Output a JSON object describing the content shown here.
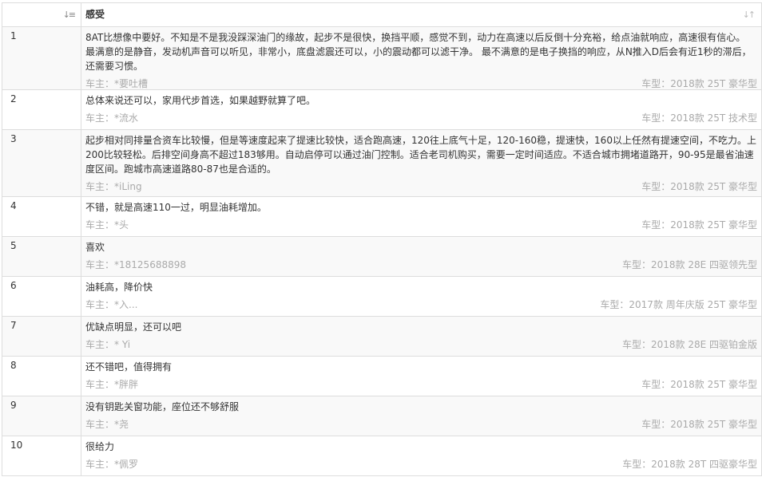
{
  "table": {
    "header": {
      "col_feeling": "感受"
    },
    "user_prefix": "车主：",
    "model_prefix": "车型：",
    "rows": [
      {
        "index": "1",
        "feeling": "8AT比想像中要好。不知是不是我没踩深油门的缘故，起步不是很快，换挡平顺，感觉不到，动力在高速以后反倒十分充裕，给点油就响应，高速很有信心。 最满意的是静音，发动机声音可以听见，非常小，底盘滤震还可以，小的震动都可以滤干净。 最不满意的是电子换挡的响应，从N推入D后会有近1秒的滞后，还需要习惯。",
        "user": "*要吐槽",
        "model": "2018款 25T 豪华型"
      },
      {
        "index": "2",
        "feeling": "总体来说还可以，家用代步首选，如果越野就算了吧。",
        "user": "*流水",
        "model": "2018款 25T 技术型"
      },
      {
        "index": "3",
        "feeling": "起步相对同排量合资车比较慢，但是等速度起来了提速比较快，适合跑高速，120往上底气十足，120-160稳，提速快，160以上任然有提速空间，不吃力。上200比较轻松。后排空间身高不超过183够用。自动启停可以通过油门控制。适合老司机购买，需要一定时间适应。不适合城市拥堵道路开，90-95是最省油速度区间。跑城市高速道路80-87也是合适的。",
        "user": "*iLing",
        "model": "2018款 25T 豪华型"
      },
      {
        "index": "4",
        "feeling": "不错，就是高速110一过，明显油耗增加。",
        "user": "*头",
        "model": "2018款 25T 豪华型"
      },
      {
        "index": "5",
        "feeling": "喜欢",
        "user": "*18125688898",
        "model": "2018款 28E 四驱领先型"
      },
      {
        "index": "6",
        "feeling": "油耗高，降价快",
        "user": "*入...",
        "model": "2017款 周年庆版 25T 豪华型"
      },
      {
        "index": "7",
        "feeling": "优缺点明显，还可以吧",
        "user": "* Yi",
        "model": "2018款 28E 四驱铂金版"
      },
      {
        "index": "8",
        "feeling": "还不错吧，值得拥有",
        "user": "*胖胖",
        "model": "2018款 25T 豪华型"
      },
      {
        "index": "9",
        "feeling": "没有钥匙关窗功能，座位还不够舒服",
        "user": "*尧",
        "model": "2018款 25T 豪华型"
      },
      {
        "index": "10",
        "feeling": "很给力",
        "user": "*佩罗",
        "model": "2018款 28T 四驱豪华型"
      }
    ]
  },
  "icons": {
    "sort_index": "sort-ascending-icon",
    "sort_feeling": "sort-both-icon"
  },
  "colors": {
    "border": "#dddddd",
    "text": "#333333",
    "muted": "#aaaaaa",
    "row_alt": "#f9f9f9"
  }
}
